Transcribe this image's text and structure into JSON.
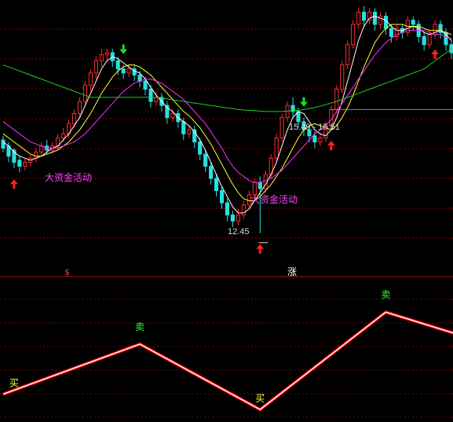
{
  "colors": {
    "background": "#000000",
    "grid": "#8b0000",
    "divider": "#b01010",
    "candle_up": "#ff2a2a",
    "candle_down": "#29e0e0",
    "ma_short": "#ffffff",
    "ma_mid": "#ffff33",
    "ma_long": "#ff33ff",
    "ma_slow": "#22cc22",
    "buy": "#ff2020",
    "sell": "#22dd22",
    "annotation": "#ff44ff",
    "price_text": "#d8d8d8",
    "signal_line_outer": "#ff0000",
    "signal_line_inner": "#ffffff",
    "buy_text": "#ffff33",
    "sell_text": "#33ff33"
  },
  "annotations": {
    "big_capital_1": "大资金活动",
    "big_capital_2": "大资金活动",
    "price_low": "12.45",
    "price_range": "15.49 - 15.51",
    "divider_left": "$",
    "divider_right": "涨"
  },
  "chart_data": [
    {
      "type": "candlestick",
      "title": "",
      "xlabel": "",
      "ylabel": "",
      "grid": true,
      "ylim": [
        12.0,
        18.2
      ],
      "price_labels": [
        {
          "index": 47,
          "value": 12.45,
          "text": "12.45"
        },
        {
          "index": 61,
          "value": 15.5,
          "text": "15.49 - 15.51"
        }
      ],
      "candles": [
        [
          14.75,
          14.55,
          14.85,
          14.45
        ],
        [
          14.6,
          14.35,
          14.7,
          14.2
        ],
        [
          14.5,
          14.2,
          14.55,
          14.05
        ],
        [
          14.25,
          14.1,
          14.35,
          13.95
        ],
        [
          14.1,
          14.2,
          14.3,
          14.0
        ],
        [
          14.2,
          14.3,
          14.4,
          14.1
        ],
        [
          14.3,
          14.45,
          14.55,
          14.2
        ],
        [
          14.45,
          14.6,
          14.7,
          14.35
        ],
        [
          14.6,
          14.5,
          14.75,
          14.4
        ],
        [
          14.5,
          14.6,
          14.7,
          14.4
        ],
        [
          14.6,
          14.8,
          14.9,
          14.5
        ],
        [
          14.8,
          14.9,
          15.05,
          14.7
        ],
        [
          14.9,
          15.15,
          15.25,
          14.8
        ],
        [
          15.15,
          15.4,
          15.5,
          15.05
        ],
        [
          15.4,
          15.7,
          15.8,
          15.3
        ],
        [
          15.7,
          16.1,
          16.2,
          15.6
        ],
        [
          16.1,
          16.4,
          16.5,
          15.95
        ],
        [
          16.4,
          16.7,
          16.8,
          16.25
        ],
        [
          16.7,
          16.85,
          17.0,
          16.55
        ],
        [
          16.85,
          16.9,
          17.0,
          16.7
        ],
        [
          16.9,
          16.7,
          17.0,
          16.55
        ],
        [
          16.7,
          16.5,
          16.8,
          16.35
        ],
        [
          16.5,
          16.4,
          16.6,
          16.25
        ],
        [
          16.4,
          16.5,
          16.6,
          16.3
        ],
        [
          16.5,
          16.35,
          16.6,
          16.2
        ],
        [
          16.35,
          16.2,
          16.45,
          16.05
        ],
        [
          16.2,
          16.0,
          16.3,
          15.85
        ],
        [
          16.0,
          15.7,
          16.1,
          15.55
        ],
        [
          15.7,
          15.8,
          15.95,
          15.6
        ],
        [
          15.8,
          15.6,
          15.9,
          15.45
        ],
        [
          15.6,
          15.3,
          15.7,
          15.15
        ],
        [
          15.3,
          15.4,
          15.5,
          15.2
        ],
        [
          15.4,
          15.2,
          15.5,
          15.05
        ],
        [
          15.2,
          14.9,
          15.3,
          14.75
        ],
        [
          14.9,
          15.0,
          15.1,
          14.8
        ],
        [
          15.0,
          14.7,
          15.1,
          14.55
        ],
        [
          14.7,
          14.4,
          14.8,
          14.25
        ],
        [
          14.4,
          14.1,
          14.5,
          13.95
        ],
        [
          14.1,
          13.8,
          14.2,
          13.65
        ],
        [
          13.8,
          13.5,
          13.9,
          13.35
        ],
        [
          13.5,
          13.2,
          13.6,
          13.05
        ],
        [
          13.2,
          12.9,
          13.3,
          12.75
        ],
        [
          12.9,
          12.75,
          13.0,
          12.6
        ],
        [
          12.75,
          12.9,
          13.05,
          12.65
        ],
        [
          12.9,
          13.15,
          13.25,
          12.8
        ],
        [
          13.15,
          13.4,
          13.5,
          13.05
        ],
        [
          13.4,
          13.7,
          13.8,
          13.3
        ],
        [
          13.7,
          13.55,
          13.85,
          12.45
        ],
        [
          13.55,
          13.9,
          14.0,
          13.45
        ],
        [
          13.9,
          14.3,
          14.4,
          13.8
        ],
        [
          14.3,
          14.8,
          14.9,
          14.2
        ],
        [
          14.8,
          15.3,
          15.4,
          14.7
        ],
        [
          15.3,
          15.6,
          15.7,
          15.2
        ],
        [
          15.6,
          15.45,
          15.8,
          15.3
        ],
        [
          15.45,
          15.2,
          15.55,
          15.05
        ],
        [
          15.2,
          15.0,
          15.3,
          14.85
        ],
        [
          15.0,
          14.85,
          15.1,
          14.7
        ],
        [
          14.85,
          14.7,
          14.95,
          14.55
        ],
        [
          14.7,
          14.8,
          14.9,
          14.6
        ],
        [
          14.8,
          15.1,
          15.2,
          14.7
        ],
        [
          15.1,
          15.5,
          15.6,
          15.0
        ],
        [
          15.5,
          16.0,
          16.1,
          15.4
        ],
        [
          16.0,
          16.6,
          16.7,
          15.9
        ],
        [
          16.6,
          17.1,
          17.2,
          16.5
        ],
        [
          17.1,
          17.6,
          17.7,
          17.0
        ],
        [
          17.6,
          17.9,
          18.0,
          17.5
        ],
        [
          17.9,
          17.7,
          18.05,
          17.55
        ],
        [
          17.7,
          17.9,
          18.0,
          17.6
        ],
        [
          17.9,
          17.6,
          18.0,
          17.45
        ],
        [
          17.6,
          17.8,
          17.9,
          17.5
        ],
        [
          17.8,
          17.5,
          17.9,
          17.35
        ],
        [
          17.5,
          17.3,
          17.6,
          17.15
        ],
        [
          17.3,
          17.5,
          17.6,
          17.2
        ],
        [
          17.5,
          17.4,
          17.6,
          17.25
        ],
        [
          17.4,
          17.7,
          17.8,
          17.3
        ],
        [
          17.7,
          17.6,
          17.8,
          17.45
        ],
        [
          17.6,
          17.3,
          17.7,
          17.15
        ],
        [
          17.3,
          17.1,
          17.4,
          16.95
        ],
        [
          17.1,
          17.35,
          17.45,
          17.0
        ],
        [
          17.35,
          17.6,
          17.7,
          17.25
        ],
        [
          17.6,
          17.4,
          17.7,
          17.25
        ],
        [
          17.4,
          17.1,
          17.5,
          16.95
        ],
        [
          17.1,
          16.9,
          17.2,
          16.75
        ]
      ],
      "moving_averages": [
        {
          "name": "MA5",
          "values": [
            14.7,
            14.6,
            14.45,
            14.35,
            14.3,
            14.25,
            14.3,
            14.35,
            14.45,
            14.55,
            14.6,
            14.75,
            14.9,
            15.1,
            15.3,
            15.6,
            15.9,
            16.2,
            16.5,
            16.7,
            16.8,
            16.75,
            16.65,
            16.55,
            16.45,
            16.4,
            16.25,
            16.05,
            15.85,
            15.7,
            15.55,
            15.45,
            15.3,
            15.2,
            15.1,
            14.95,
            14.75,
            14.5,
            14.2,
            13.9,
            13.6,
            13.35,
            13.1,
            12.95,
            12.95,
            13.05,
            13.25,
            13.45,
            13.65,
            13.9,
            14.2,
            14.6,
            15.0,
            15.3,
            15.45,
            15.4,
            15.2,
            15.0,
            14.9,
            14.85,
            15.0,
            15.3,
            15.7,
            16.2,
            16.7,
            17.2,
            17.55,
            17.75,
            17.8,
            17.75,
            17.7,
            17.55,
            17.45,
            17.45,
            17.5,
            17.55,
            17.5,
            17.4,
            17.35,
            17.4,
            17.45,
            17.35,
            17.2
          ]
        },
        {
          "name": "MA10",
          "values": [
            14.9,
            14.8,
            14.7,
            14.6,
            14.5,
            14.4,
            14.35,
            14.35,
            14.4,
            14.45,
            14.5,
            14.6,
            14.7,
            14.85,
            15.0,
            15.2,
            15.4,
            15.65,
            15.9,
            16.1,
            16.3,
            16.45,
            16.55,
            16.6,
            16.6,
            16.55,
            16.45,
            16.35,
            16.2,
            16.05,
            15.9,
            15.75,
            15.6,
            15.45,
            15.35,
            15.2,
            15.05,
            14.85,
            14.65,
            14.4,
            14.15,
            13.9,
            13.65,
            13.45,
            13.3,
            13.25,
            13.25,
            13.35,
            13.5,
            13.65,
            13.85,
            14.05,
            14.3,
            14.55,
            14.8,
            15.0,
            15.1,
            15.15,
            15.1,
            15.05,
            15.0,
            15.1,
            15.3,
            15.55,
            15.85,
            16.2,
            16.55,
            16.85,
            17.15,
            17.35,
            17.5,
            17.6,
            17.6,
            17.6,
            17.55,
            17.55,
            17.55,
            17.5,
            17.45,
            17.45,
            17.45,
            17.4,
            17.35
          ]
        },
        {
          "name": "MA20",
          "values": [
            15.2,
            15.1,
            15.0,
            14.9,
            14.8,
            14.7,
            14.65,
            14.6,
            14.55,
            14.55,
            14.55,
            14.6,
            14.65,
            14.7,
            14.8,
            14.9,
            15.05,
            15.2,
            15.35,
            15.5,
            15.65,
            15.8,
            15.95,
            16.05,
            16.15,
            16.2,
            16.25,
            16.25,
            16.2,
            16.15,
            16.05,
            15.95,
            15.85,
            15.75,
            15.6,
            15.45,
            15.3,
            15.15,
            14.95,
            14.75,
            14.55,
            14.3,
            14.1,
            13.95,
            13.85,
            13.75,
            13.7,
            13.7,
            13.75,
            13.8,
            13.9,
            14.0,
            14.15,
            14.3,
            14.45,
            14.6,
            14.75,
            14.9,
            15.0,
            15.1,
            15.25,
            15.45,
            15.65,
            15.85,
            16.05,
            16.25,
            16.45,
            16.65,
            16.85,
            17.0,
            17.15,
            17.25,
            17.35,
            17.4,
            17.45,
            17.45,
            17.45,
            17.45,
            17.4,
            17.35,
            17.35,
            17.3,
            17.25
          ]
        },
        {
          "name": "MA60",
          "values": [
            16.6,
            16.55,
            16.5,
            16.45,
            16.4,
            16.35,
            16.3,
            16.25,
            16.2,
            16.15,
            16.1,
            16.05,
            16.0,
            15.95,
            15.9,
            15.85,
            15.8,
            15.8,
            15.8,
            15.8,
            15.8,
            15.8,
            15.8,
            15.8,
            15.8,
            15.8,
            15.8,
            15.8,
            15.8,
            15.78,
            15.76,
            15.74,
            15.72,
            15.7,
            15.68,
            15.66,
            15.64,
            15.62,
            15.6,
            15.58,
            15.56,
            15.54,
            15.52,
            15.5,
            15.49,
            15.48,
            15.47,
            15.46,
            15.45,
            15.45,
            15.45,
            15.45,
            15.46,
            15.47,
            15.48,
            15.5,
            15.52,
            15.55,
            15.58,
            15.62,
            15.66,
            15.7,
            15.75,
            15.8,
            15.85,
            15.9,
            15.95,
            16.0,
            16.05,
            16.1,
            16.15,
            16.2,
            16.25,
            16.3,
            16.35,
            16.4,
            16.45,
            16.5,
            16.6,
            16.7,
            16.8,
            16.9,
            17.0
          ]
        }
      ],
      "signals": [
        {
          "index": 2,
          "type": "buy"
        },
        {
          "index": 22,
          "type": "sell"
        },
        {
          "index": 47,
          "type": "buy"
        },
        {
          "index": 55,
          "type": "sell"
        },
        {
          "index": 60,
          "type": "buy"
        },
        {
          "index": 79,
          "type": "buy"
        }
      ],
      "text_annotations": [
        {
          "index": 8,
          "value": 14.4,
          "key": "big_capital_1"
        },
        {
          "index": 52,
          "value": 13.4,
          "key": "big_capital_2"
        }
      ]
    },
    {
      "type": "line",
      "title": "",
      "xlabel": "",
      "ylabel": "",
      "grid": true,
      "ylim": [
        0,
        10
      ],
      "series": [
        {
          "values": [
            [
              0,
              2.0
            ],
            [
              25,
              5.6
            ],
            [
              47,
              0.9
            ],
            [
              70,
              7.9
            ],
            [
              84,
              6.2
            ]
          ]
        }
      ],
      "labels": [
        {
          "text": "买",
          "index": 2,
          "value": 2.0,
          "kind": "buy"
        },
        {
          "text": "卖",
          "index": 25,
          "value": 5.6,
          "kind": "sell"
        },
        {
          "text": "买",
          "index": 47,
          "value": 0.9,
          "kind": "buy"
        },
        {
          "text": "卖",
          "index": 70,
          "value": 7.9,
          "kind": "sell"
        }
      ]
    }
  ]
}
